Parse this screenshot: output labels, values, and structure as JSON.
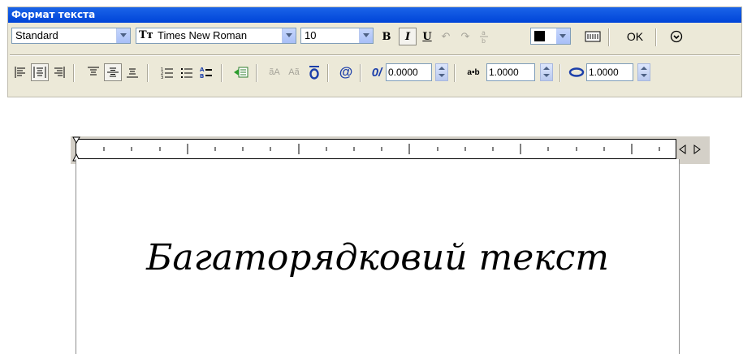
{
  "window": {
    "title": "Формат текста"
  },
  "toolbar1": {
    "style": {
      "value": "Standard"
    },
    "font": {
      "prefix_icon_text": "Tт",
      "value": "Times New Roman"
    },
    "height": {
      "value": "10"
    },
    "bold_label": "B",
    "italic_label": "I",
    "underline_label": "U",
    "color": {
      "value": "#000000"
    },
    "ok_label": "OK"
  },
  "toolbar2": {
    "case_lower_label": "ãA",
    "case_upper_label": "Aã",
    "symbol_label": "@",
    "oblique": {
      "icon_text": "0/",
      "value": "0.0000"
    },
    "tracking": {
      "icon_text": "a•b",
      "value": "1.0000"
    },
    "width": {
      "value": "1.0000"
    }
  },
  "editor": {
    "sample_text": "Багаторядковий текст"
  },
  "colors": {
    "title_bar": "#0a5be0",
    "panel": "#ece9d8"
  }
}
